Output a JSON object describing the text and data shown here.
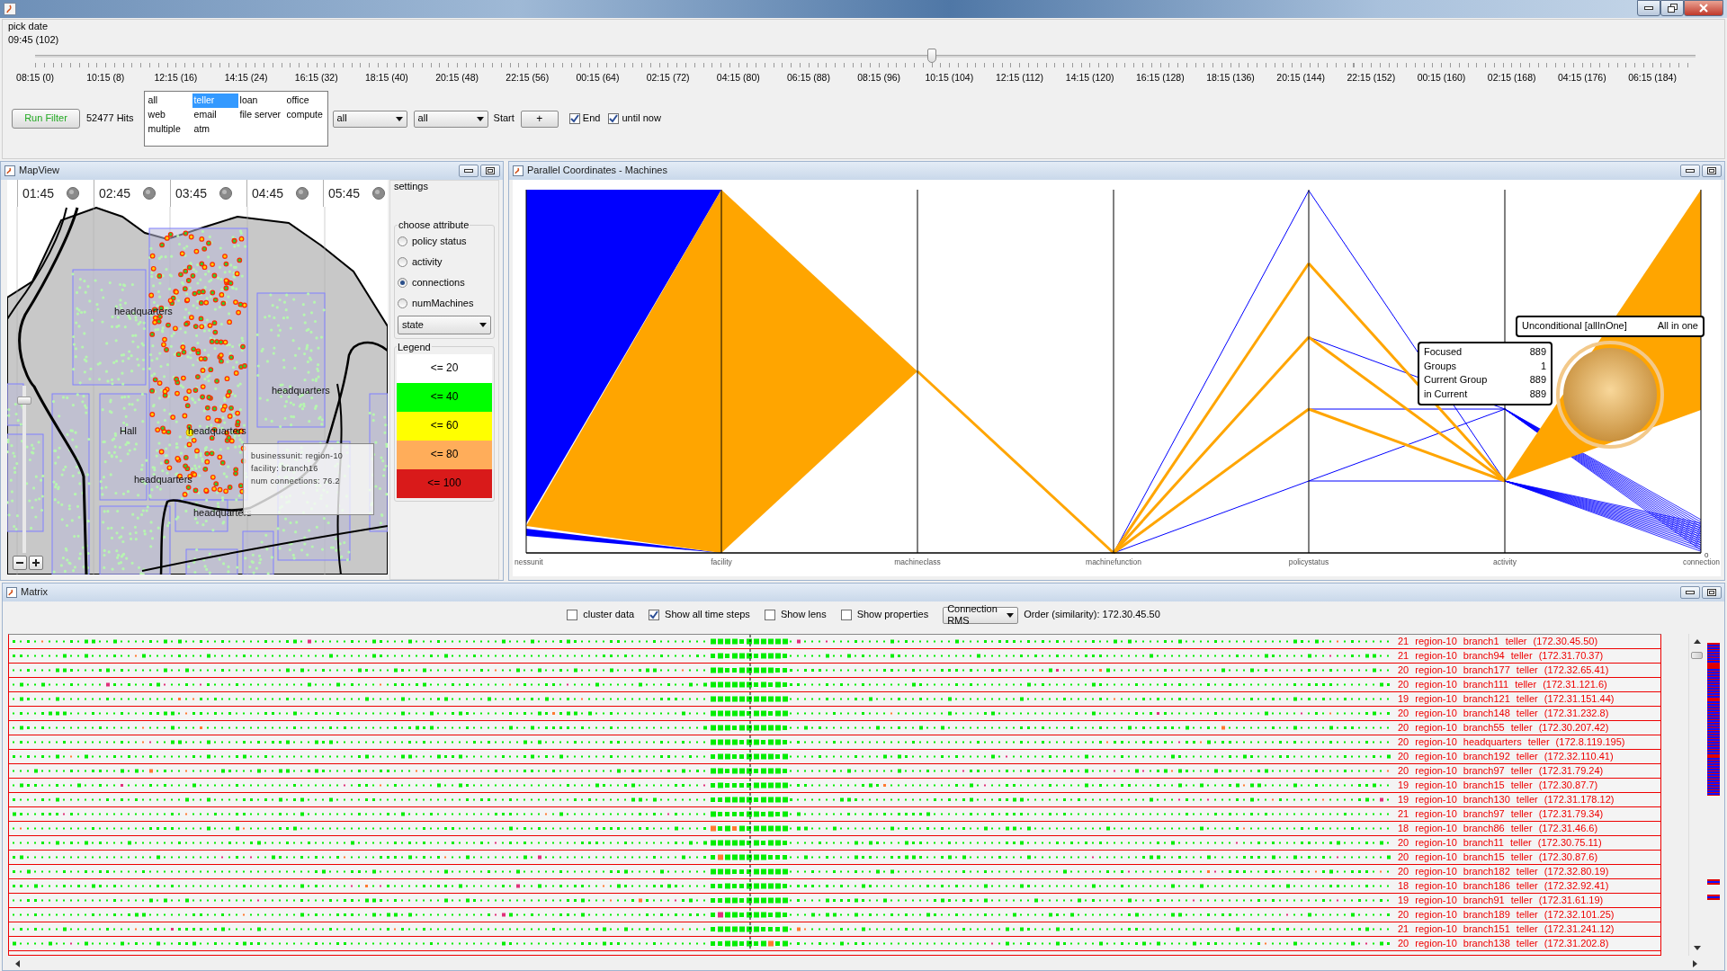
{
  "date_picker": {
    "label": "pick date",
    "value": "09:45 (102)",
    "level": 0.54,
    "ticks": [
      "08:15 (0)",
      "10:15 (8)",
      "12:15 (16)",
      "14:15 (24)",
      "16:15 (32)",
      "18:15 (40)",
      "20:15 (48)",
      "22:15 (56)",
      "00:15 (64)",
      "02:15 (72)",
      "04:15 (80)",
      "06:15 (88)",
      "08:15 (96)",
      "10:15 (104)",
      "12:15 (112)",
      "14:15 (120)",
      "16:15 (128)",
      "18:15 (136)",
      "20:15 (144)",
      "22:15 (152)",
      "00:15 (160)",
      "02:15 (168)",
      "04:15 (176)",
      "06:15 (184)"
    ]
  },
  "filter": {
    "run_button": "Run Filter",
    "hits": "52477 Hits",
    "types": [
      {
        "label": "all",
        "selected": false
      },
      {
        "label": "teller",
        "selected": true
      },
      {
        "label": "loan",
        "selected": false
      },
      {
        "label": "office",
        "selected": false
      },
      {
        "label": "web",
        "selected": false
      },
      {
        "label": "email",
        "selected": false
      },
      {
        "label": "file server",
        "selected": false
      },
      {
        "label": "compute",
        "selected": false
      },
      {
        "label": "multiple",
        "selected": false
      },
      {
        "label": "atm",
        "selected": false
      }
    ],
    "selects": [
      "all",
      "all"
    ],
    "start_label": "Start",
    "add_button": "+",
    "checks": [
      {
        "label": "End",
        "checked": true
      },
      {
        "label": "until now",
        "checked": true
      }
    ]
  },
  "map_view": {
    "title": "MapView",
    "times": [
      "01:45",
      "02:45",
      "03:45",
      "04:45",
      "05:45"
    ],
    "labels": [
      "headquarters",
      "headquarters",
      "headquarters",
      "headquarters",
      "headquarters",
      "Hall"
    ],
    "tooltip": [
      "businessunit: region-10",
      "facility: branch16",
      "num connections: 76.2"
    ],
    "zoom": {
      "level": 0.93
    },
    "settings": {
      "title": "settings",
      "group_title": "choose attribute",
      "options": [
        {
          "label": "policy status",
          "selected": false
        },
        {
          "label": "activity",
          "selected": false
        },
        {
          "label": "connections",
          "selected": true
        },
        {
          "label": "numMachines",
          "selected": false
        }
      ],
      "select": "state",
      "legend_title": "Legend",
      "legend": [
        {
          "label": "<= 20",
          "color": "#ffffff"
        },
        {
          "label": "<= 40",
          "color": "#00ff00"
        },
        {
          "label": "<= 60",
          "color": "#ffff00"
        },
        {
          "label": "<= 80",
          "color": "#ffad5a"
        },
        {
          "label": "<= 100",
          "color": "#d91a1a"
        }
      ]
    }
  },
  "parallel_coordinates": {
    "title": "Parallel Coordinates - Machines",
    "axes": [
      "nessunit",
      "facility",
      "machineclass",
      "machinefunction",
      "policystatus",
      "activity",
      "connection"
    ],
    "axis_min": "0",
    "group_tip": {
      "name": "Unconditional [allInOne]",
      "value": "All in one"
    },
    "stats": [
      {
        "label": "Focused",
        "value": "889"
      },
      {
        "label": "Groups",
        "value": "1"
      },
      {
        "label": "Current Group",
        "value": "889"
      },
      {
        "label": "in Current",
        "value": "889"
      }
    ]
  },
  "matrix": {
    "title": "Matrix",
    "options": [
      {
        "label": "cluster data",
        "checked": false
      },
      {
        "label": "Show all time steps",
        "checked": true
      },
      {
        "label": "Show lens",
        "checked": false
      },
      {
        "label": "Show properties",
        "checked": false
      }
    ],
    "measure": "Connection RMS",
    "order": "Order (similarity): 172.30.45.50",
    "rows": [
      {
        "label": "21 region-10 branch1 teller (172.30.45.50)"
      },
      {
        "label": "21 region-10 branch94 teller (172.31.70.37)"
      },
      {
        "label": "20 region-10 branch177 teller (172.32.65.41)"
      },
      {
        "label": "20 region-10 branch111 teller (172.31.121.6)"
      },
      {
        "label": "19 region-10 branch121 teller (172.31.151.44)"
      },
      {
        "label": "20 region-10 branch148 teller (172.31.232.8)"
      },
      {
        "label": "20 region-10 branch55 teller (172.30.207.42)"
      },
      {
        "label": "20 region-10 headquarters teller (172.8.119.195)"
      },
      {
        "label": "20 region-10 branch192 teller (172.32.110.41)"
      },
      {
        "label": "20 region-10 branch97 teller (172.31.79.24)"
      },
      {
        "label": "19 region-10 branch15 teller (172.30.87.7)"
      },
      {
        "label": "19 region-10 branch130 teller (172.31.178.12)"
      },
      {
        "label": "21 region-10 branch97 teller (172.31.79.34)"
      },
      {
        "label": "18 region-10 branch86 teller (172.31.46.6)"
      },
      {
        "label": "20 region-10 branch11 teller (172.30.75.11)"
      },
      {
        "label": "20 region-10 branch15 teller (172.30.87.6)"
      },
      {
        "label": "20 region-10 branch182 teller (172.32.80.19)"
      },
      {
        "label": "18 region-10 branch186 teller (172.32.92.41)"
      },
      {
        "label": "19 region-10 branch91 teller (172.31.61.19)"
      },
      {
        "label": "20 region-10 branch189 teller (172.32.101.25)"
      },
      {
        "label": "21 region-10 branch151 teller (172.31.241.12)"
      },
      {
        "label": "20 region-10 branch138 teller (172.31.202.8)"
      }
    ]
  }
}
